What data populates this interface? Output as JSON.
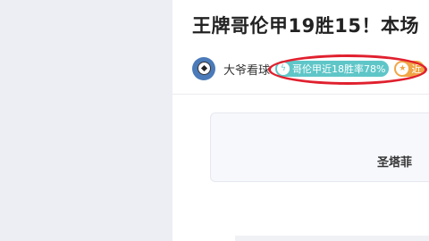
{
  "article": {
    "title": "王牌哥伦甲19胜15！本场",
    "author": {
      "name": "大爷看球"
    },
    "tags": [
      {
        "label": "哥伦甲近18胜率78%",
        "icon": "bolt-icon",
        "color": "#5fc6c8"
      },
      {
        "label": "近",
        "icon": "star-icon",
        "color": "#f0a546"
      }
    ],
    "annotation_color": "#e0202e"
  },
  "match_card": {
    "team_name": "圣塔菲",
    "accent_color": "#e0202e"
  }
}
